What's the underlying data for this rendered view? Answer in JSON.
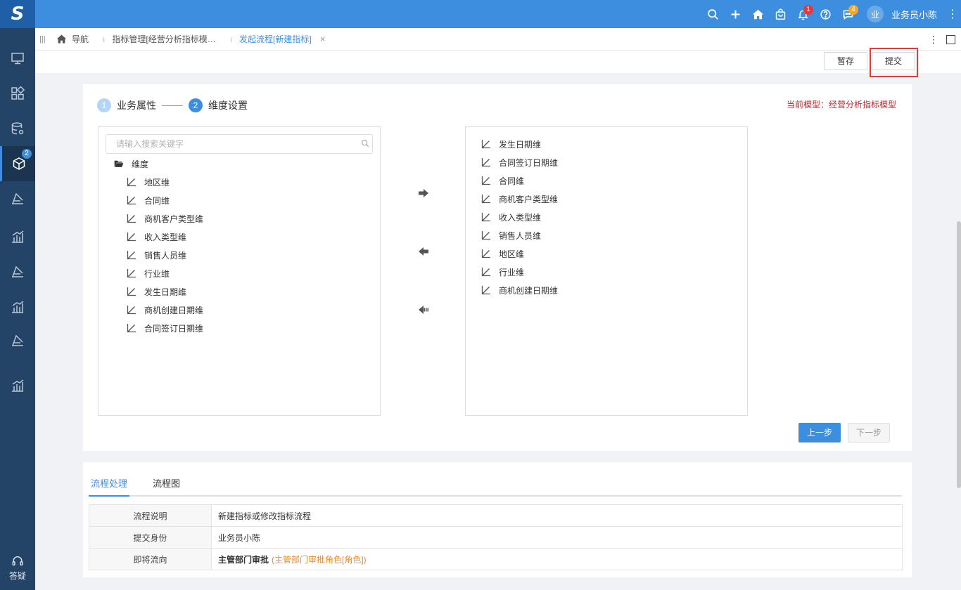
{
  "app": {
    "logo_text": "S",
    "user_avatar": "业",
    "user_name": "业务员小陈",
    "top_icons": [
      "search-icon",
      "plus-icon",
      "home-icon",
      "bag-icon",
      "bell-icon",
      "help-icon",
      "chat-icon",
      "more-vertical-icon"
    ],
    "bell_badge": "1",
    "chat_badge": "4",
    "colors": {
      "topbar": "#3e8ee0",
      "sidebar": "#234466",
      "accent": "#3e8ee0",
      "highlight": "#e23b3b"
    }
  },
  "sidebar": {
    "items": [
      "monitor-icon",
      "apps-icon",
      "database-icon",
      "cube-icon",
      "process-icon",
      "chart-icon",
      "process-icon",
      "chart-icon",
      "process-icon",
      "chart-icon"
    ],
    "active_badge": "2",
    "help_label": "答疑"
  },
  "tabs": {
    "nav_label": "导航",
    "items": [
      {
        "label": "指标管理[经营分析指标模…"
      },
      {
        "label": "发起流程[新建指标]"
      }
    ],
    "close_glyph": "×"
  },
  "toolbar": {
    "save_draft_label": "暂存",
    "submit_label": "提交"
  },
  "wizard": {
    "steps": [
      {
        "num": "1",
        "label": "业务属性"
      },
      {
        "num": "2",
        "label": "维度设置"
      }
    ],
    "model_tip": "当前模型：经营分析指标模型",
    "search_placeholder": "请输入搜索关键字",
    "folder_label": "维度",
    "left_items": [
      "地区维",
      "合同维",
      "商机客户类型维",
      "收入类型维",
      "销售人员维",
      "行业维",
      "发生日期维",
      "商机创建日期维",
      "合同签订日期维"
    ],
    "right_items": [
      "发生日期维",
      "合同签订日期维",
      "合同维",
      "商机客户类型维",
      "收入类型维",
      "销售人员维",
      "地区维",
      "行业维",
      "商机创建日期维"
    ],
    "prev_label": "上一步",
    "next_label": "下一步"
  },
  "process": {
    "tabs": [
      "流程处理",
      "流程图"
    ],
    "rows": [
      {
        "key": "流程说明",
        "value": "新建指标或修改指标流程"
      },
      {
        "key": "提交身份",
        "value": "业务员小陈"
      },
      {
        "key": "即将流向",
        "value": "主管部门审批",
        "extra": "(主管部门审批角色[角色])"
      }
    ]
  }
}
